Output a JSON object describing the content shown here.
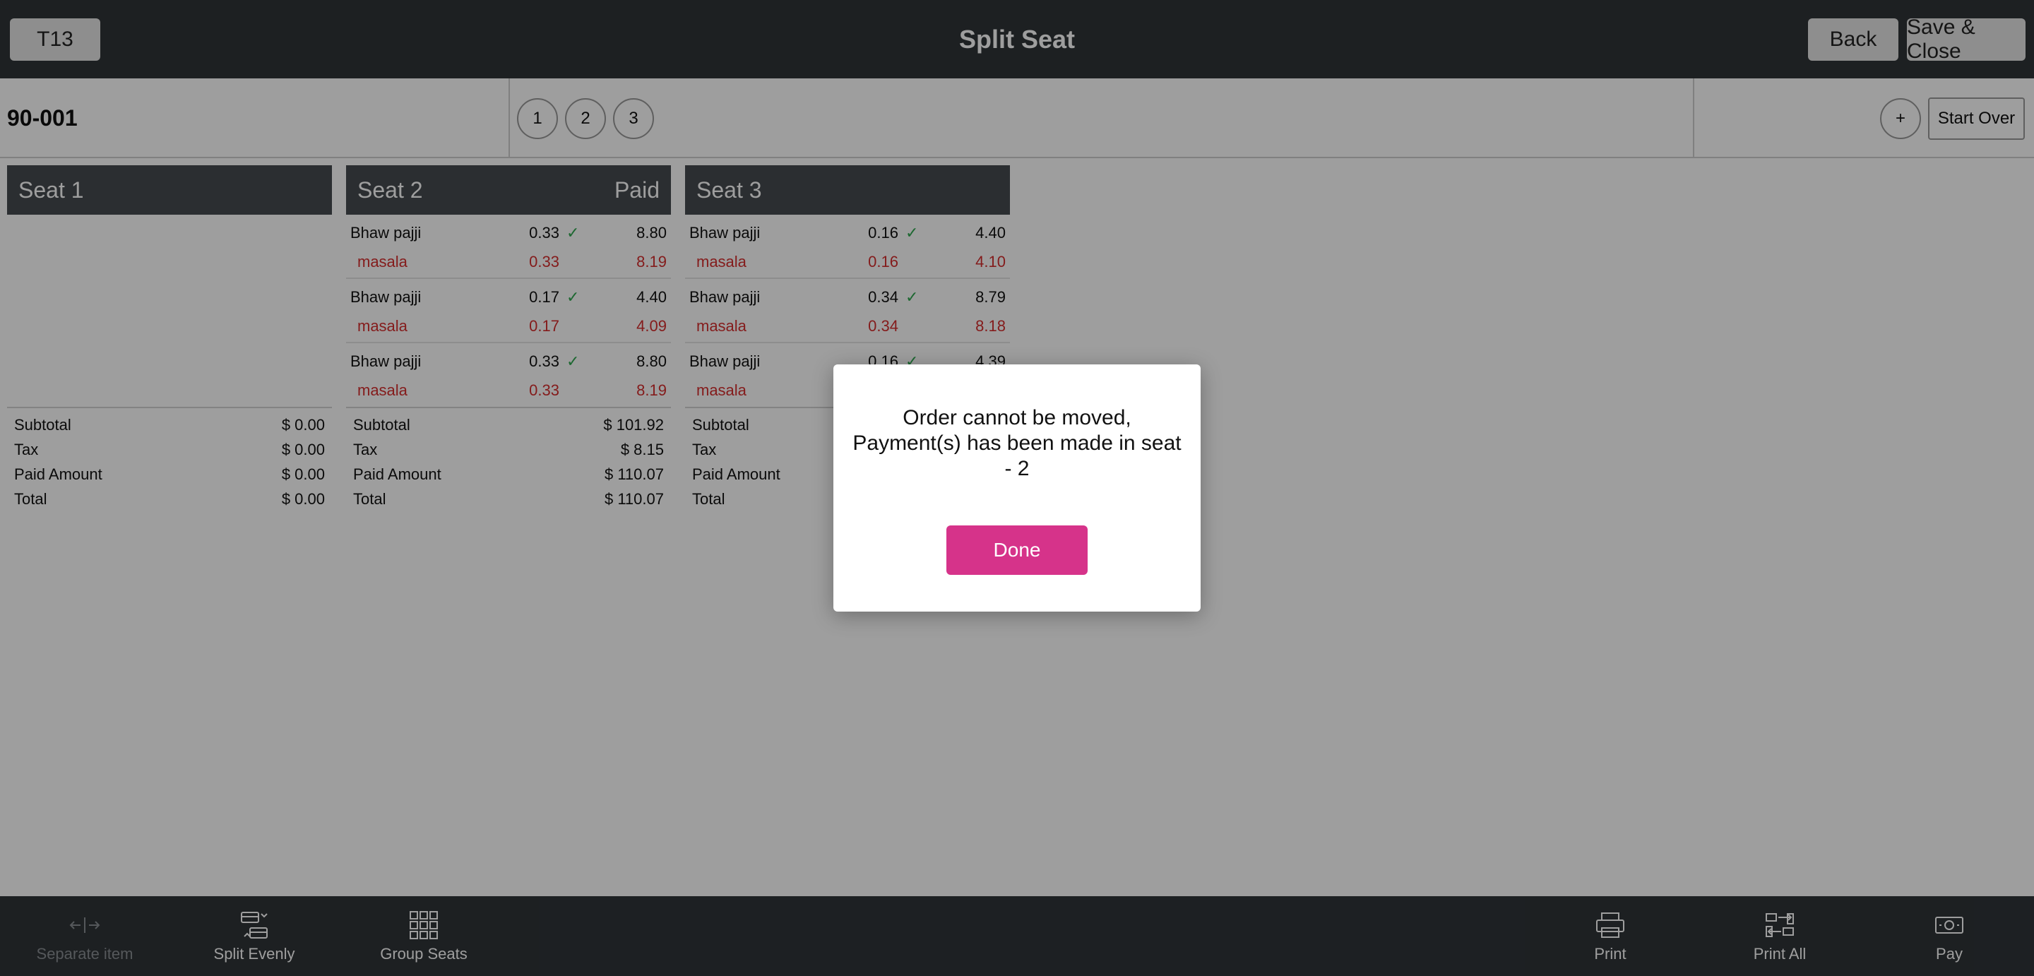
{
  "header": {
    "table_button": "T13",
    "title": "Split Seat",
    "back_label": "Back",
    "save_close_label": "Save & Close"
  },
  "order": {
    "id": "90-001",
    "seat_tabs": [
      "1",
      "2",
      "3"
    ],
    "add_label": "+",
    "start_over_label": "Start Over"
  },
  "seats": [
    {
      "title": "Seat 1",
      "status": "",
      "items": [],
      "subtotal_label": "Subtotal",
      "subtotal": "$ 0.00",
      "tax_label": "Tax",
      "tax": "$ 0.00",
      "paid_label": "Paid Amount",
      "paid": "$ 0.00",
      "total_label": "Total",
      "total": "$ 0.00"
    },
    {
      "title": "Seat 2",
      "status": "Paid",
      "items": [
        {
          "name": "Bhaw pajji",
          "qty": "0.33",
          "amount": "8.80",
          "mod_name": "masala",
          "mod_qty": "0.33",
          "mod_amount": "8.19"
        },
        {
          "name": "Bhaw pajji",
          "qty": "0.17",
          "amount": "4.40",
          "mod_name": "masala",
          "mod_qty": "0.17",
          "mod_amount": "4.09"
        },
        {
          "name": "Bhaw pajji",
          "qty": "0.33",
          "amount": "8.80",
          "mod_name": "masala",
          "mod_qty": "0.33",
          "mod_amount": "8.19"
        }
      ],
      "subtotal_label": "Subtotal",
      "subtotal": "$ 101.92",
      "tax_label": "Tax",
      "tax": "$ 8.15",
      "paid_label": "Paid Amount",
      "paid": "$ 110.07",
      "total_label": "Total",
      "total": "$ 110.07"
    },
    {
      "title": "Seat 3",
      "status": "",
      "items": [
        {
          "name": "Bhaw pajji",
          "qty": "0.16",
          "amount": "4.40",
          "mod_name": "masala",
          "mod_qty": "0.16",
          "mod_amount": "4.10"
        },
        {
          "name": "Bhaw pajji",
          "qty": "0.34",
          "amount": "8.79",
          "mod_name": "masala",
          "mod_qty": "0.34",
          "mod_amount": "8.18"
        },
        {
          "name": "Bhaw pajji",
          "qty": "0.16",
          "amount": "4.39",
          "mod_name": "masala",
          "mod_qty": "",
          "mod_amount": ""
        }
      ],
      "subtotal_label": "Subtotal",
      "subtotal": "",
      "tax_label": "Tax",
      "tax": "",
      "paid_label": "Paid Amount",
      "paid": "",
      "total_label": "Total",
      "total": ""
    }
  ],
  "dialog": {
    "message": "Order cannot be moved, Payment(s) has been made in seat - 2",
    "done_label": "Done"
  },
  "toolbar": {
    "separate_item": "Separate item",
    "split_evenly": "Split Evenly",
    "group_seats": "Group Seats",
    "print": "Print",
    "print_all": "Print All",
    "pay": "Pay"
  },
  "icons": {
    "separate_item": "separate-arrows-icon",
    "split_evenly": "split-evenly-icon",
    "group_seats": "grid-icon",
    "print": "printer-icon",
    "print_all": "print-all-icon",
    "pay": "cash-icon",
    "check": "checkmark-icon"
  },
  "colors": {
    "bar": "#2f3438",
    "accent": "#d6338a",
    "modifier": "#d62e2e",
    "check": "#2fa84f"
  }
}
